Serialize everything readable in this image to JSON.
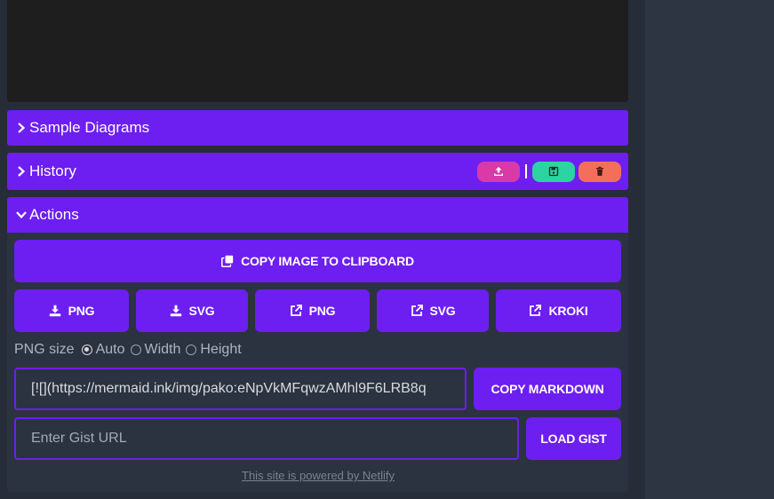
{
  "panels": {
    "sample_diagrams": "Sample Diagrams",
    "history": "History",
    "actions": "Actions"
  },
  "history_buttons": [
    {
      "icon": "upload-icon",
      "color": "#d93aa8"
    },
    {
      "icon": "save-icon",
      "color": "#2dd3a0"
    },
    {
      "icon": "trash-icon",
      "color": "#f2705b"
    }
  ],
  "actions": {
    "copy_image": "COPY IMAGE TO CLIPBOARD",
    "download_png": "PNG",
    "download_svg": "SVG",
    "open_png": "PNG",
    "open_svg": "SVG",
    "open_kroki": "KROKI",
    "png_size_label": "PNG size",
    "png_size_options": [
      "Auto",
      "Width",
      "Height"
    ],
    "png_size_selected": "Auto",
    "markdown_value": "[![](https://mermaid.ink/img/pako:eNpVkMFqwzAMhl9F6LRB8q",
    "copy_markdown": "COPY MARKDOWN",
    "gist_placeholder": "Enter Gist URL",
    "load_gist": "LOAD GIST"
  },
  "footer": "This site is powered by Netlify",
  "colors": {
    "accent": "#6d1ef0",
    "background": "#262d38",
    "preview": "#1e1e1e"
  }
}
